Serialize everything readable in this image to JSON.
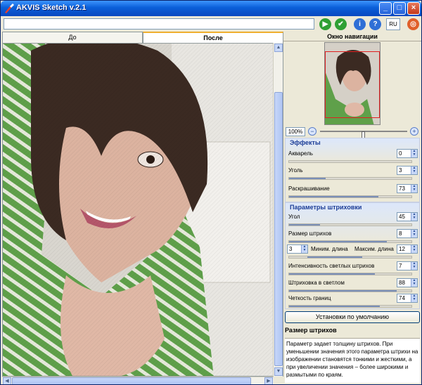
{
  "window": {
    "title": "AKVIS Sketch v.2.1",
    "min": "_",
    "max": "□",
    "close": "×"
  },
  "toolbar": {
    "path_value": "",
    "run_glyph": "▶",
    "apply_glyph": "✔",
    "info_glyph": "i",
    "help_glyph": "?",
    "language": "RU",
    "plugin_glyph": "◎"
  },
  "tabs": {
    "before": "До",
    "after": "После"
  },
  "navigator": {
    "title": "Окно навигации",
    "zoom": "100%",
    "zoom_level": 0.5,
    "zoom_out": "−",
    "zoom_in": "+"
  },
  "effects": {
    "title": "Эффекты",
    "params": [
      {
        "label": "Акварель",
        "value": "0",
        "max": 100
      },
      {
        "label": "Уголь",
        "value": "3",
        "max": 10
      },
      {
        "label": "Раскрашивание",
        "value": "73",
        "max": 100
      }
    ]
  },
  "strokes": {
    "title": "Параметры штриховки",
    "angle": {
      "label": "Угол",
      "value": "45",
      "max": 180
    },
    "size": {
      "label": "Размер штрихов",
      "value": "8",
      "max": 10
    },
    "min_label": "Миним. длина",
    "min_value": "3",
    "max_label": "Максим. длина",
    "max_value": "12",
    "length_range": [
      3,
      12
    ],
    "length_max": 20,
    "light": {
      "label": "Интенсивность светлых штрихов",
      "value": "7",
      "max": 10
    },
    "hatch": {
      "label": "Штриховка в светлом",
      "value": "88",
      "max": 100
    },
    "edges": {
      "label": "Четкость границ",
      "value": "74",
      "max": 100
    }
  },
  "default_button": "Установки по умолчанию",
  "help": {
    "title": "Размер штрихов",
    "text": "Параметр задает толщину штрихов. При уменьшении значения этого параметра штрихи на изображении становятся тонкими и жесткими, а при увеличении значения – более широкими и размытыми по краям."
  },
  "colors": {
    "title_bar": "#0a5fd8",
    "accent": "#1b3c96",
    "run_button": "#2fa034",
    "apply_button": "#2fa034",
    "info_button": "#2f6fd6",
    "plugin_button": "#e0602a"
  },
  "icons": {
    "app": "akvis-brush-icon",
    "run": "run-icon",
    "apply": "apply-icon",
    "info": "info-icon",
    "help": "help-icon",
    "plugin": "plugin-icon"
  }
}
